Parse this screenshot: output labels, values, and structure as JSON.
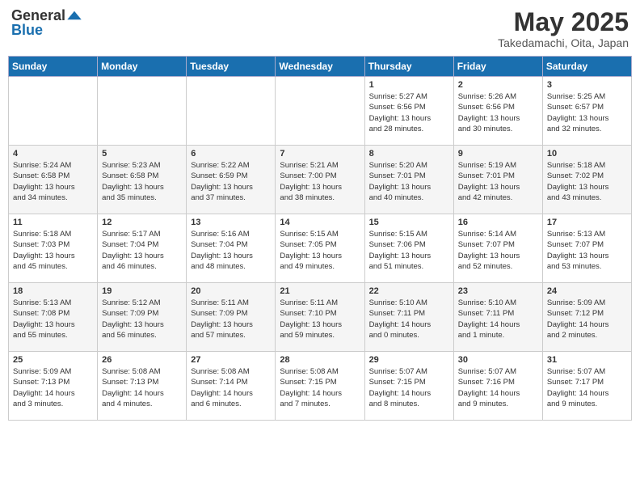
{
  "header": {
    "logo_general": "General",
    "logo_blue": "Blue",
    "month_title": "May 2025",
    "location": "Takedamachi, Oita, Japan"
  },
  "weekdays": [
    "Sunday",
    "Monday",
    "Tuesday",
    "Wednesday",
    "Thursday",
    "Friday",
    "Saturday"
  ],
  "weeks": [
    [
      {
        "day": "",
        "info": ""
      },
      {
        "day": "",
        "info": ""
      },
      {
        "day": "",
        "info": ""
      },
      {
        "day": "",
        "info": ""
      },
      {
        "day": "1",
        "info": "Sunrise: 5:27 AM\nSunset: 6:56 PM\nDaylight: 13 hours\nand 28 minutes."
      },
      {
        "day": "2",
        "info": "Sunrise: 5:26 AM\nSunset: 6:56 PM\nDaylight: 13 hours\nand 30 minutes."
      },
      {
        "day": "3",
        "info": "Sunrise: 5:25 AM\nSunset: 6:57 PM\nDaylight: 13 hours\nand 32 minutes."
      }
    ],
    [
      {
        "day": "4",
        "info": "Sunrise: 5:24 AM\nSunset: 6:58 PM\nDaylight: 13 hours\nand 34 minutes."
      },
      {
        "day": "5",
        "info": "Sunrise: 5:23 AM\nSunset: 6:58 PM\nDaylight: 13 hours\nand 35 minutes."
      },
      {
        "day": "6",
        "info": "Sunrise: 5:22 AM\nSunset: 6:59 PM\nDaylight: 13 hours\nand 37 minutes."
      },
      {
        "day": "7",
        "info": "Sunrise: 5:21 AM\nSunset: 7:00 PM\nDaylight: 13 hours\nand 38 minutes."
      },
      {
        "day": "8",
        "info": "Sunrise: 5:20 AM\nSunset: 7:01 PM\nDaylight: 13 hours\nand 40 minutes."
      },
      {
        "day": "9",
        "info": "Sunrise: 5:19 AM\nSunset: 7:01 PM\nDaylight: 13 hours\nand 42 minutes."
      },
      {
        "day": "10",
        "info": "Sunrise: 5:18 AM\nSunset: 7:02 PM\nDaylight: 13 hours\nand 43 minutes."
      }
    ],
    [
      {
        "day": "11",
        "info": "Sunrise: 5:18 AM\nSunset: 7:03 PM\nDaylight: 13 hours\nand 45 minutes."
      },
      {
        "day": "12",
        "info": "Sunrise: 5:17 AM\nSunset: 7:04 PM\nDaylight: 13 hours\nand 46 minutes."
      },
      {
        "day": "13",
        "info": "Sunrise: 5:16 AM\nSunset: 7:04 PM\nDaylight: 13 hours\nand 48 minutes."
      },
      {
        "day": "14",
        "info": "Sunrise: 5:15 AM\nSunset: 7:05 PM\nDaylight: 13 hours\nand 49 minutes."
      },
      {
        "day": "15",
        "info": "Sunrise: 5:15 AM\nSunset: 7:06 PM\nDaylight: 13 hours\nand 51 minutes."
      },
      {
        "day": "16",
        "info": "Sunrise: 5:14 AM\nSunset: 7:07 PM\nDaylight: 13 hours\nand 52 minutes."
      },
      {
        "day": "17",
        "info": "Sunrise: 5:13 AM\nSunset: 7:07 PM\nDaylight: 13 hours\nand 53 minutes."
      }
    ],
    [
      {
        "day": "18",
        "info": "Sunrise: 5:13 AM\nSunset: 7:08 PM\nDaylight: 13 hours\nand 55 minutes."
      },
      {
        "day": "19",
        "info": "Sunrise: 5:12 AM\nSunset: 7:09 PM\nDaylight: 13 hours\nand 56 minutes."
      },
      {
        "day": "20",
        "info": "Sunrise: 5:11 AM\nSunset: 7:09 PM\nDaylight: 13 hours\nand 57 minutes."
      },
      {
        "day": "21",
        "info": "Sunrise: 5:11 AM\nSunset: 7:10 PM\nDaylight: 13 hours\nand 59 minutes."
      },
      {
        "day": "22",
        "info": "Sunrise: 5:10 AM\nSunset: 7:11 PM\nDaylight: 14 hours\nand 0 minutes."
      },
      {
        "day": "23",
        "info": "Sunrise: 5:10 AM\nSunset: 7:11 PM\nDaylight: 14 hours\nand 1 minute."
      },
      {
        "day": "24",
        "info": "Sunrise: 5:09 AM\nSunset: 7:12 PM\nDaylight: 14 hours\nand 2 minutes."
      }
    ],
    [
      {
        "day": "25",
        "info": "Sunrise: 5:09 AM\nSunset: 7:13 PM\nDaylight: 14 hours\nand 3 minutes."
      },
      {
        "day": "26",
        "info": "Sunrise: 5:08 AM\nSunset: 7:13 PM\nDaylight: 14 hours\nand 4 minutes."
      },
      {
        "day": "27",
        "info": "Sunrise: 5:08 AM\nSunset: 7:14 PM\nDaylight: 14 hours\nand 6 minutes."
      },
      {
        "day": "28",
        "info": "Sunrise: 5:08 AM\nSunset: 7:15 PM\nDaylight: 14 hours\nand 7 minutes."
      },
      {
        "day": "29",
        "info": "Sunrise: 5:07 AM\nSunset: 7:15 PM\nDaylight: 14 hours\nand 8 minutes."
      },
      {
        "day": "30",
        "info": "Sunrise: 5:07 AM\nSunset: 7:16 PM\nDaylight: 14 hours\nand 9 minutes."
      },
      {
        "day": "31",
        "info": "Sunrise: 5:07 AM\nSunset: 7:17 PM\nDaylight: 14 hours\nand 9 minutes."
      }
    ]
  ]
}
